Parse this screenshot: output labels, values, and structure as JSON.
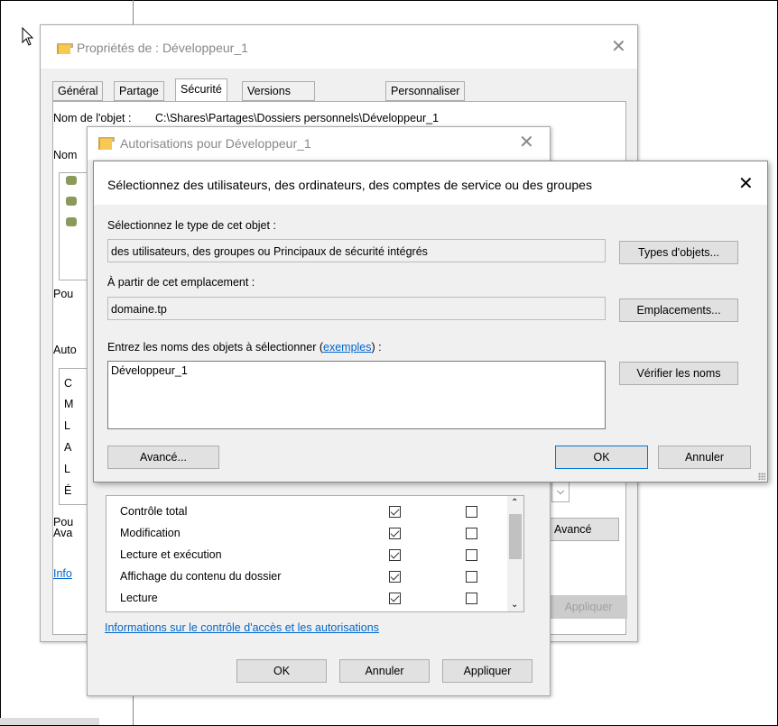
{
  "props_dialog": {
    "title": "Propriétés de : Développeur_1",
    "tabs": [
      "Général",
      "Partage",
      "Sécurité",
      "Versions précédentes",
      "Personnaliser"
    ],
    "object_name_label": "Nom de l'objet :",
    "object_name_value": "C:\\Shares\\Partages\\Dossiers personnels\\Développeur_1",
    "partial_labels": [
      "Nom",
      "Pou",
      "Auto",
      "Pou",
      "Ava",
      "Info"
    ],
    "partial_list_letters": [
      "C",
      "M",
      "L",
      "A",
      "L",
      "É"
    ],
    "advanced_button": "Avancé",
    "apply_button": "Appliquer"
  },
  "perm_dialog": {
    "title": "Autorisations pour Développeur_1",
    "permissions": [
      {
        "name": "Contrôle total",
        "allow": true,
        "deny": false
      },
      {
        "name": "Modification",
        "allow": true,
        "deny": false
      },
      {
        "name": "Lecture et exécution",
        "allow": true,
        "deny": false
      },
      {
        "name": "Affichage du contenu du dossier",
        "allow": true,
        "deny": false
      },
      {
        "name": "Lecture",
        "allow": true,
        "deny": false
      }
    ],
    "info_link": "Informations sur le contrôle d'accès et les autorisations",
    "ok_button": "OK",
    "cancel_button": "Annuler",
    "apply_button": "Appliquer"
  },
  "select_dialog": {
    "title": "Sélectionnez des utilisateurs, des ordinateurs, des comptes de service ou des groupes",
    "object_type_label": "Sélectionnez le type de cet objet :",
    "object_type_value": "des utilisateurs, des groupes ou Principaux de sécurité intégrés",
    "object_types_button": "Types d'objets...",
    "location_label": "À partir de cet emplacement :",
    "location_value": "domaine.tp",
    "locations_button": "Emplacements...",
    "enter_names_label": "Entrez les noms des objets à sélectionner (",
    "examples_link": "exemples",
    "enter_names_label_end": ") :",
    "names_value": "Développeur_1",
    "check_names_button": "Vérifier les noms",
    "advanced_button": "Avancé...",
    "ok_button": "OK",
    "cancel_button": "Annuler"
  }
}
